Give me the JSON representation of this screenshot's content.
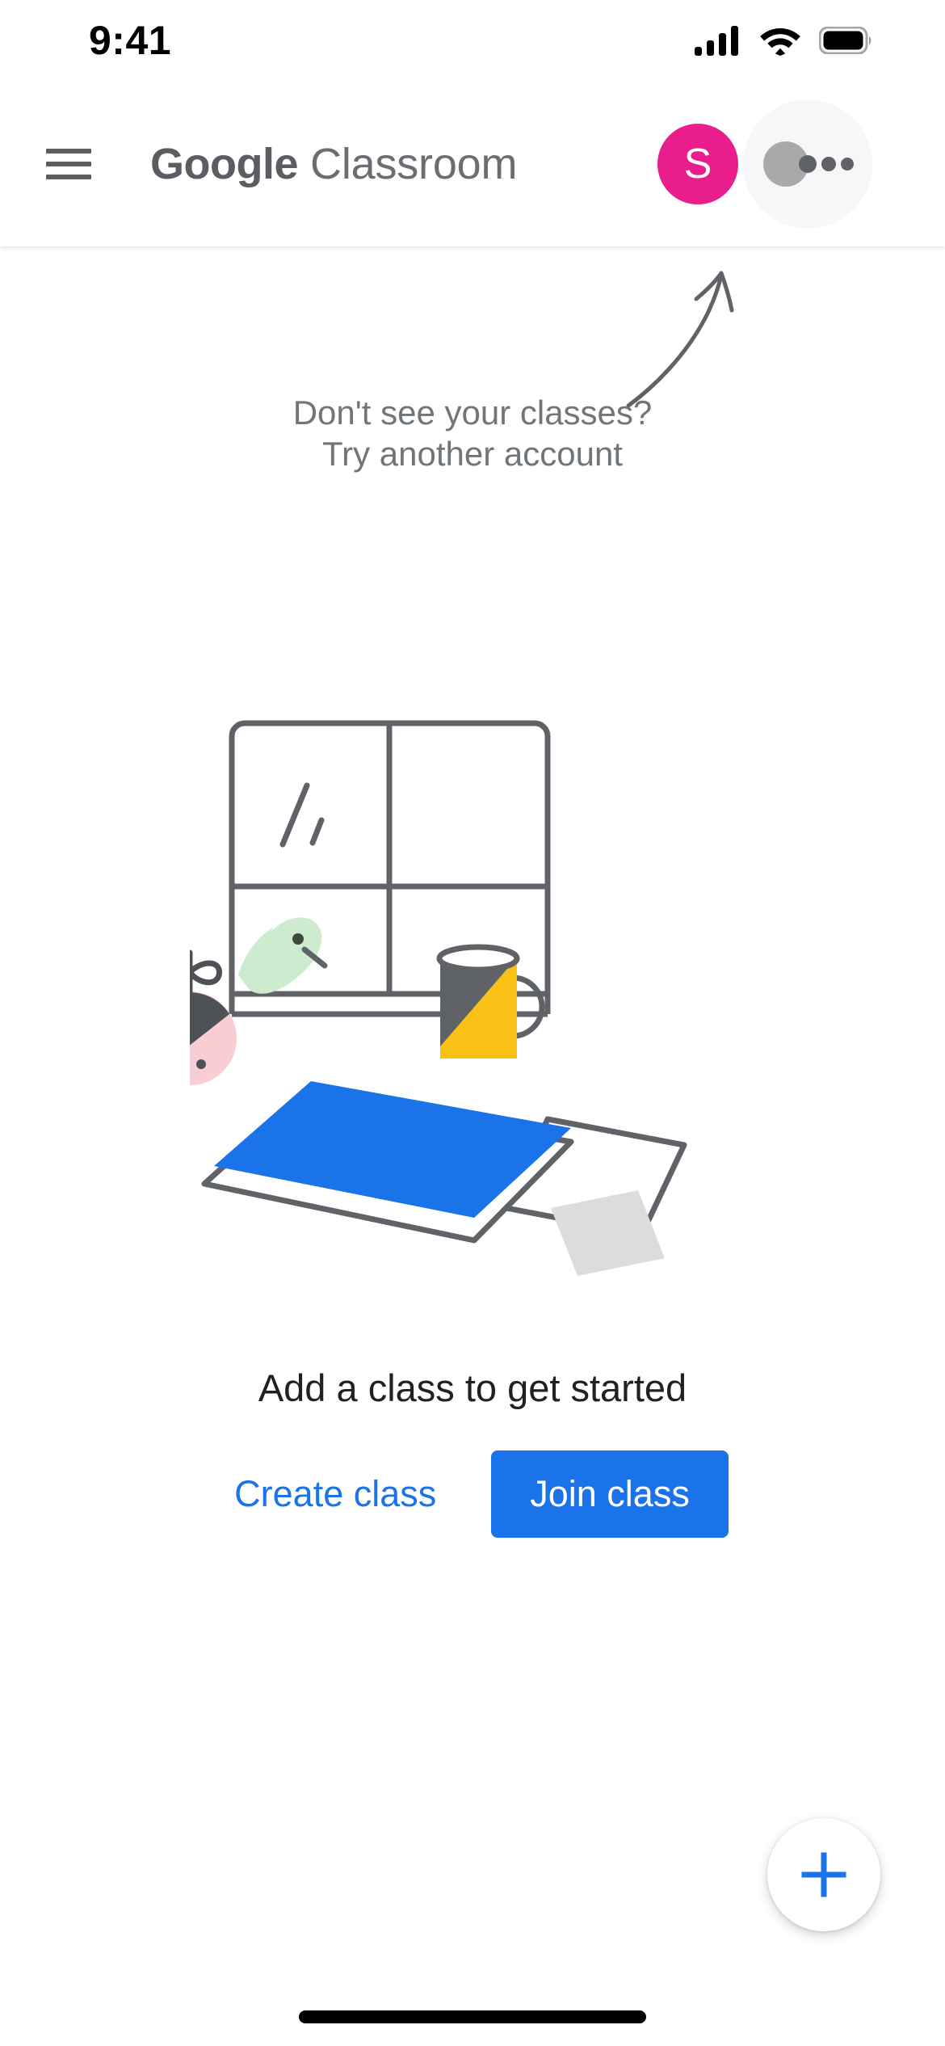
{
  "status_bar": {
    "time": "9:41",
    "icons": [
      "cellular-signal-icon",
      "wifi-icon",
      "battery-icon"
    ]
  },
  "app_bar": {
    "menu_icon": "hamburger-menu-icon",
    "title_brand": "Google",
    "title_product": "Classroom",
    "avatar_initial": "S",
    "avatar_color": "#E91E8C",
    "touch_indicator": "touch-pointer-indicator"
  },
  "hint": {
    "arrow": "curved-arrow-up-icon",
    "line1": "Don't see your classes?",
    "line2": "Try another account",
    "color": "#70757a"
  },
  "illustration": {
    "name": "empty-classroom-illustration",
    "parts": [
      "window-frame",
      "window-shine-marks",
      "green-bird",
      "yellow-mug",
      "pink-plant-pot",
      "blue-folder",
      "white-paper",
      "gray-paper"
    ],
    "colors": {
      "outline": "#5f6368",
      "bird": "#cdeccf",
      "mug_body": "#F9C016",
      "mug_shade": "#5f6368",
      "pot_pink": "#F9CDD3",
      "pot_shade": "#4e5156",
      "folder_blue": "#1a73e8",
      "paper_gray": "#dcdcdc"
    }
  },
  "empty_state": {
    "title": "Add a class to get started",
    "create_label": "Create class",
    "join_label": "Join class",
    "link_color": "#1a73e8",
    "button_color": "#1a73e8"
  },
  "fab": {
    "icon": "plus-icon",
    "color": "#1a73e8"
  },
  "home_indicator": "home-indicator-bar"
}
